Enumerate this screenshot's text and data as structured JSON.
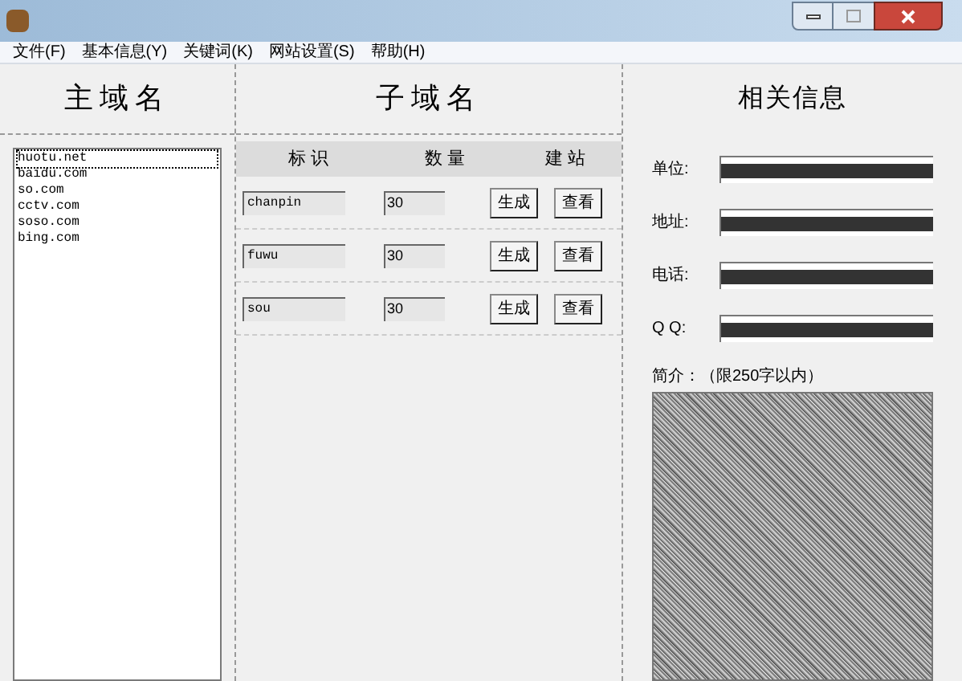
{
  "menu": [
    {
      "label": "文件(F)"
    },
    {
      "label": "基本信息(Y)"
    },
    {
      "label": "关键词(K)"
    },
    {
      "label": "网站设置(S)"
    },
    {
      "label": "帮助(H)"
    }
  ],
  "domains": {
    "title": "主域名",
    "items": [
      {
        "label": "huotu.net",
        "selected": true
      },
      {
        "label": "baidu.com",
        "selected": false
      },
      {
        "label": "so.com",
        "selected": false
      },
      {
        "label": "cctv.com",
        "selected": false
      },
      {
        "label": "soso.com",
        "selected": false
      },
      {
        "label": "bing.com",
        "selected": false
      }
    ]
  },
  "subdomains": {
    "title": "子域名",
    "columns": [
      "标 识",
      "数 量",
      "建 站"
    ],
    "rows": [
      {
        "id": "chanpin",
        "count": "30",
        "generate": "生成",
        "view": "查看"
      },
      {
        "id": "fuwu",
        "count": "30",
        "generate": "生成",
        "view": "查看"
      },
      {
        "id": "sou",
        "count": "30",
        "generate": "生成",
        "view": "查看"
      }
    ]
  },
  "info": {
    "title": "相关信息",
    "fields": [
      {
        "label": "单位:"
      },
      {
        "label": "地址:"
      },
      {
        "label": "电话:"
      },
      {
        "label": "Q Q:"
      }
    ],
    "intro_label": "简介：（限250字以内）"
  }
}
